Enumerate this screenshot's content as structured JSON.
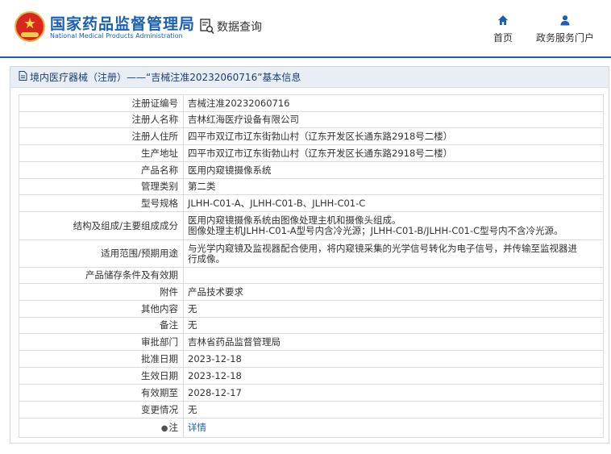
{
  "header": {
    "brand_cn": "国家药品监督管理局",
    "brand_en": "National Medical Products Administration",
    "query_label": "数据查询",
    "nav": {
      "home": "首页",
      "portal": "政务服务门户"
    }
  },
  "breadcrumb": "境内医疗器械（注册）——“吉械注准20232060716”基本信息",
  "colors": {
    "brand_blue": "#1b5fb1",
    "emblem_red": "#d8281d",
    "emblem_gold": "#f0c94f"
  },
  "icons": [
    "emblem-icon",
    "search-document-icon",
    "home-icon",
    "user-icon",
    "document-icon",
    "pin-icon"
  ],
  "rows": [
    {
      "key": "注册证编号",
      "value": "吉械注准20232060716"
    },
    {
      "key": "注册人名称",
      "value": "吉林红海医疗设备有限公司"
    },
    {
      "key": "注册人住所",
      "value": "四平市双辽市辽东街勃山村（辽东开发区长通东路2918号二楼）"
    },
    {
      "key": "生产地址",
      "value": "四平市双辽市辽东街勃山村（辽东开发区长通东路2918号二楼）"
    },
    {
      "key": "产品名称",
      "value": "医用内窥镜摄像系统"
    },
    {
      "key": "管理类别",
      "value": "第二类"
    },
    {
      "key": "型号规格",
      "value": "JLHH-C01-A、JLHH-C01-B、JLHH-C01-C"
    },
    {
      "key": "结构及组成/主要组成成分",
      "value": "医用内窥镜摄像系统由图像处理主机和摄像头组成。",
      "value2": "图像处理主机JLHH-C01-A型号内含冷光源；JLHH-C01-B/JLHH-C01-C型号内不含冷光源。"
    },
    {
      "key": "适用范围/预期用途",
      "value": "与光学内窥镜及监视器配合使用，将内窥镜采集的光学信号转化为电子信号，并传输至监视器进",
      "value2": "行成像。"
    },
    {
      "key": "产品储存条件及有效期",
      "value": ""
    },
    {
      "key": "附件",
      "value": "产品技术要求"
    },
    {
      "key": "其他内容",
      "value": "无"
    },
    {
      "key": "备注",
      "value": "无"
    },
    {
      "key": "审批部门",
      "value": "吉林省药品监督管理局"
    },
    {
      "key": "批准日期",
      "value": "2023-12-18"
    },
    {
      "key": "生效日期",
      "value": "2023-12-18"
    },
    {
      "key": "有效期至",
      "value": "2028-12-17"
    },
    {
      "key": "变更情况",
      "value": "无"
    }
  ],
  "note_row": {
    "key": "注",
    "link": "详情"
  }
}
